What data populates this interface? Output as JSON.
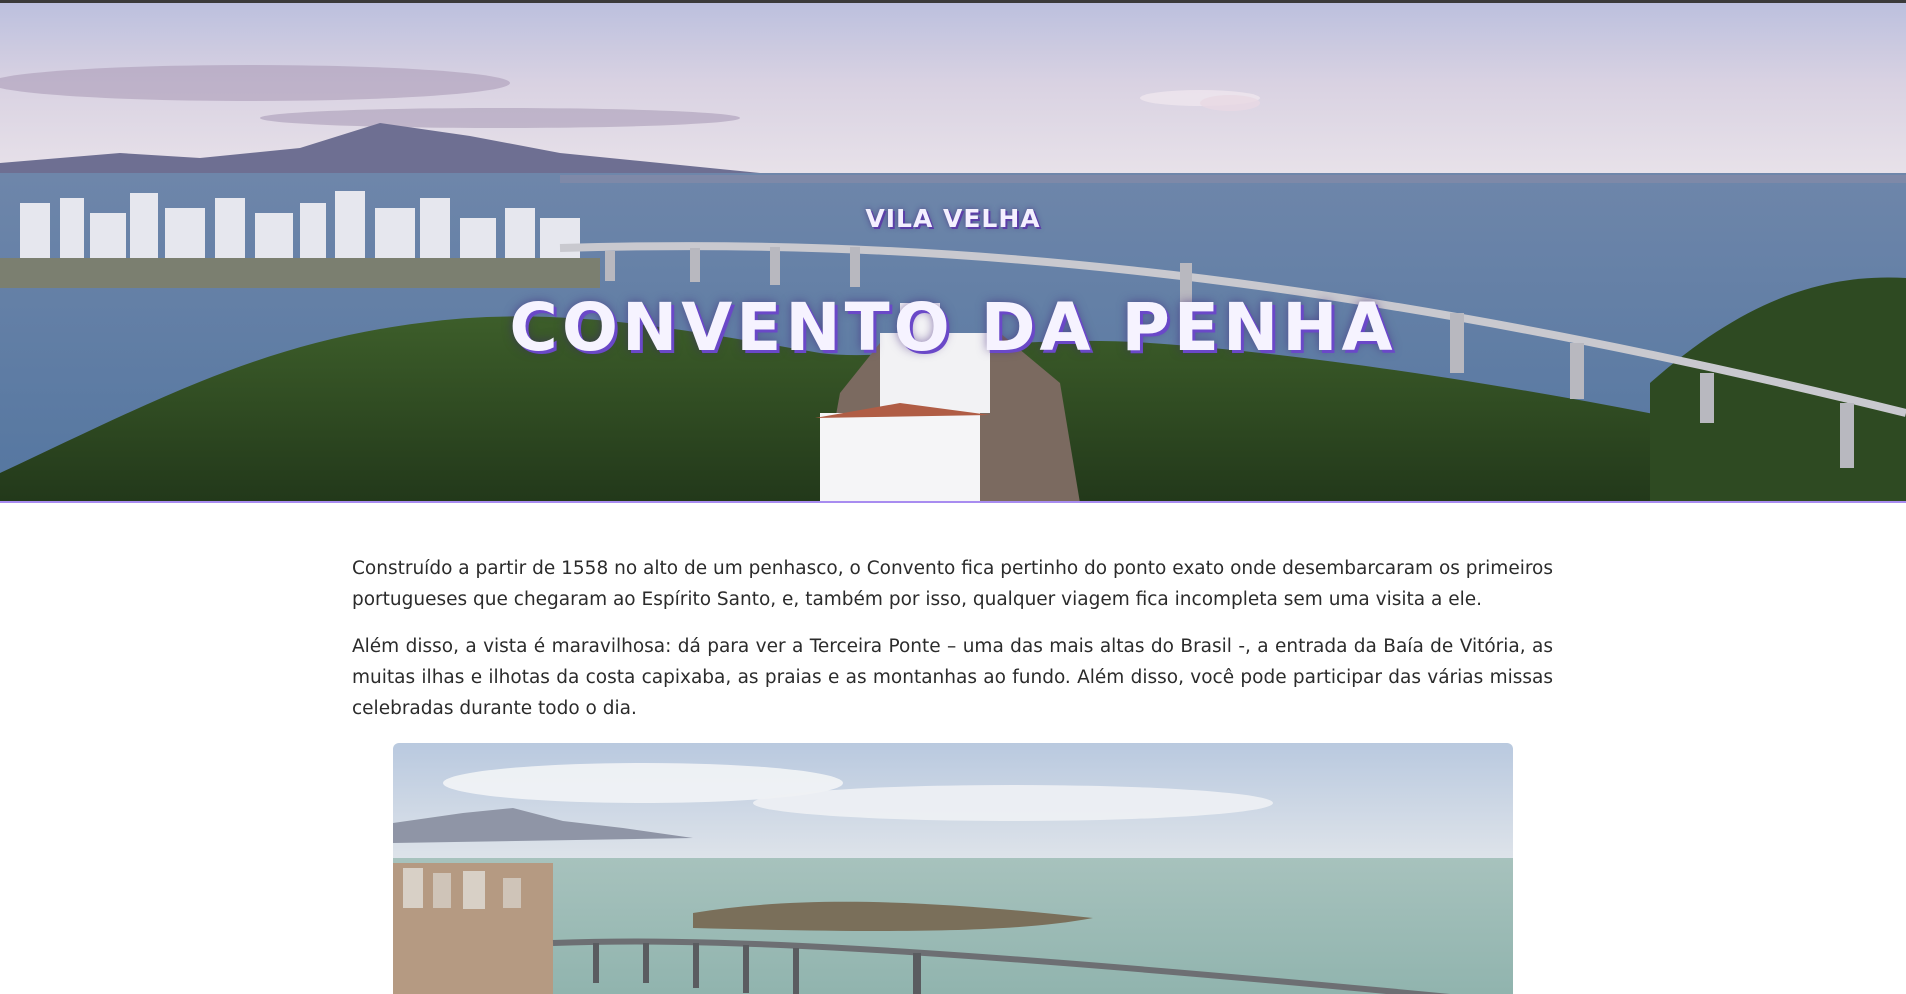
{
  "hero": {
    "subtitle": "VILA VELHA",
    "title": "CONVENTO DA PENHA",
    "image": "aerial-view-convento-da-penha-and-terceira-ponte"
  },
  "article": {
    "paragraphs": [
      "Construído a partir de 1558 no alto de um penhasco, o Convento fica pertinho do ponto exato onde desembarcaram os primeiros portugueses que chegaram ao Espírito Santo, e, também por isso, qualquer viagem fica incompleta sem uma visita a ele.",
      "Além disso, a vista é maravilhosa: dá para ver a Terceira Ponte – uma das mais altas do Brasil -, a entrada da Baía de Vitória, as muitas ilhas e ilhotas da costa capixaba, as praias e as montanhas ao fundo. Além disso, você pode participar das várias missas celebradas durante todo o dia."
    ],
    "photo": "aerial-view-bay-and-bridge"
  },
  "colors": {
    "accent": "#a88cf0",
    "title_shadow": "#6a48c8",
    "text": "#2b2b2b",
    "topbar": "#3a3a3a"
  }
}
